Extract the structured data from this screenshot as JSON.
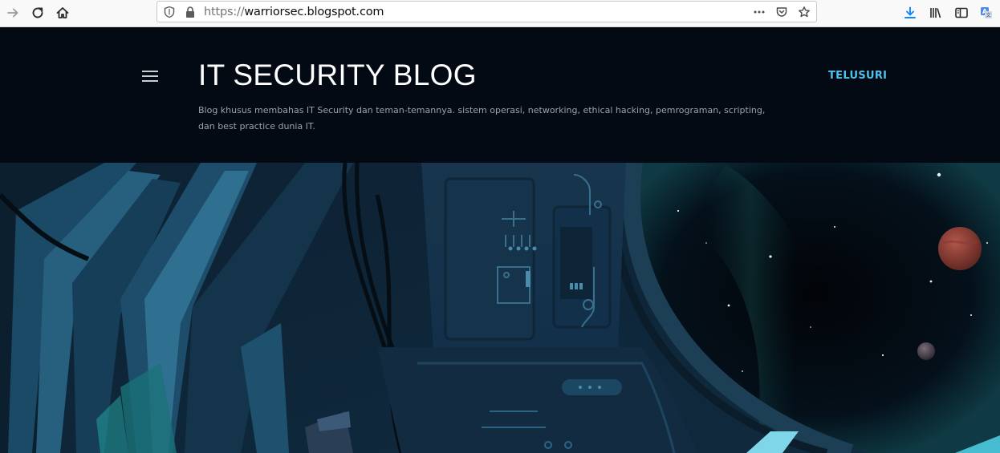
{
  "browser": {
    "url_protocol": "https://",
    "url_host": "warriorsec.blogspot.com",
    "icons": {
      "back": "arrow-right-icon",
      "reload": "reload-icon",
      "home": "home-icon",
      "shield": "tracking-protection-shield-icon",
      "lock": "lock-icon",
      "more": "more-dots-icon",
      "pocket": "pocket-icon",
      "bookmark": "star-icon",
      "downloads": "download-icon",
      "library": "library-icon",
      "sidebar": "sidebar-icon",
      "translate": "translate-icon"
    },
    "accent_color": "#0a84ff"
  },
  "blog": {
    "title": "IT SECURITY BLOG",
    "description": "Blog khusus membahas IT Security dan teman-temannya. sistem operasi, networking, ethical hacking, pemrograman, scripting, dan best practice dunia IT.",
    "search_label": "TELUSURI",
    "header_bg": "#030a14",
    "link_color": "#4fc3e8"
  },
  "hero": {
    "alt_icon": "spaceship-interior-illustration-image"
  }
}
